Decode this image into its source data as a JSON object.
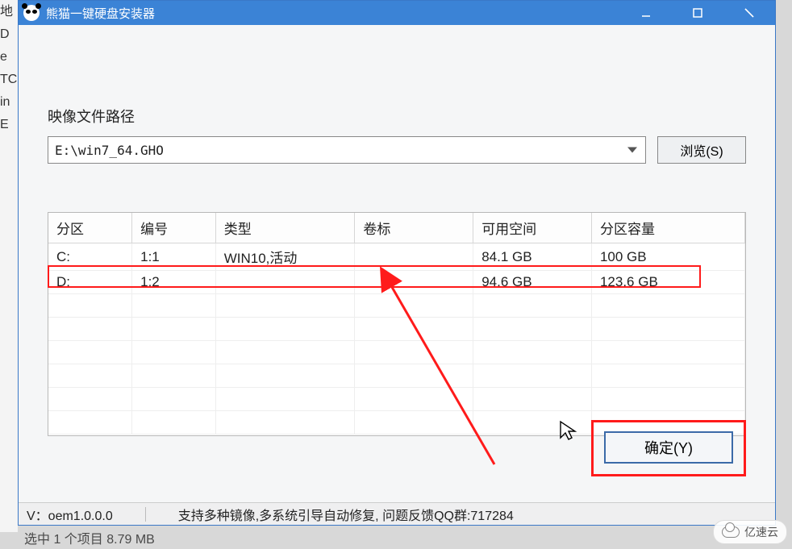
{
  "window": {
    "title": "熊猫一键硬盘安装器"
  },
  "path": {
    "label": "映像文件路径",
    "value": "E:\\win7_64.GHO",
    "browse_label": "浏览(S)"
  },
  "table": {
    "headers": {
      "partition": "分区",
      "number": "编号",
      "type": "类型",
      "volume": "卷标",
      "free": "可用空间",
      "capacity": "分区容量"
    },
    "rows": [
      {
        "partition": "C:",
        "number": "1:1",
        "type": "WIN10,活动",
        "volume": "",
        "free": "84.1 GB",
        "capacity": "100 GB"
      },
      {
        "partition": "D:",
        "number": "1:2",
        "type": "",
        "volume": "",
        "free": "94.6 GB",
        "capacity": "123.6 GB"
      }
    ]
  },
  "buttons": {
    "ok": "确定(Y)"
  },
  "status": {
    "version_label": "V：oem1.0.0.0",
    "info": "支持多种镜像,多系统引导自动修复, 问题反馈QQ群:717284"
  },
  "below": "选中 1 个项目  8.79 MB",
  "watermark": "亿速云"
}
